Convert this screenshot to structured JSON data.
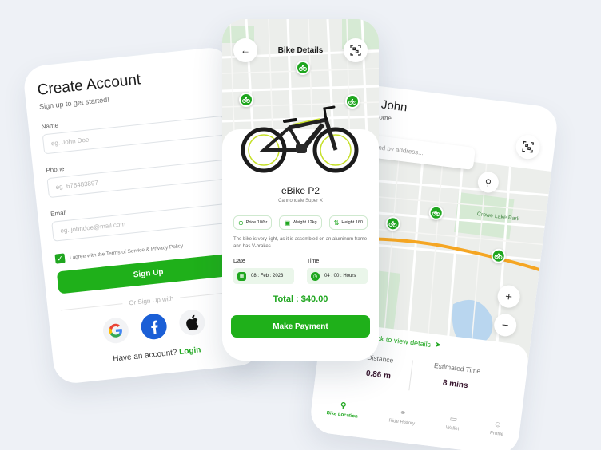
{
  "signup": {
    "title": "Create Account",
    "subtitle": "Sign up to get started!",
    "fields": [
      {
        "label": "Name",
        "placeholder": "eg. John Doe"
      },
      {
        "label": "Phone",
        "placeholder": "eg. 678483897"
      },
      {
        "label": "Email",
        "placeholder": "eg. johndoe@mail.com"
      }
    ],
    "agree_text": "I agree with the Terms of Service & Privacy Policy",
    "signup_button": "Sign Up",
    "or_text": "Or Sign Up with",
    "social_icons": [
      "google-icon",
      "facebook-icon",
      "apple-icon"
    ],
    "have_account": "Have an account?",
    "login_link": "Login"
  },
  "bike_details": {
    "title": "Bike Details",
    "name": "eBike P2",
    "model": "Cannondale Super X",
    "specs": [
      {
        "icon": "price-icon",
        "label": "Price 10/hr"
      },
      {
        "icon": "weight-icon",
        "label": "Weight 12kg"
      },
      {
        "icon": "height-icon",
        "label": "Height 160"
      }
    ],
    "description": "The bike is very light, as it is assembled on an aluminum frame and has V-brakes",
    "date_label": "Date",
    "date_value": "08 : Feb : 2023",
    "time_label": "Time",
    "time_value": "04 : 00 : Hours",
    "total": "Total : $40.00",
    "pay_button": "Make Payment"
  },
  "location": {
    "greeting": "Hi John",
    "welcome": "Welcome",
    "search_placeholder": "Find by address...",
    "view_details": "Click to view details",
    "distance_label": "Distance",
    "distance_value": "0.86 m",
    "time_label": "Estimated Time",
    "time_value": "8 mins",
    "nav": [
      {
        "label": "Bike Location",
        "icon": "location-icon",
        "active": true
      },
      {
        "label": "Ride History",
        "icon": "bike-icon",
        "active": false
      },
      {
        "label": "Wallet",
        "icon": "wallet-icon",
        "active": false
      },
      {
        "label": "Profile",
        "icon": "profile-icon",
        "active": false
      }
    ],
    "map_labels": [
      "Crowe Lake Park"
    ]
  },
  "colors": {
    "accent": "#1fb01a",
    "background": "#eef1f6",
    "route": "#f5a623"
  }
}
